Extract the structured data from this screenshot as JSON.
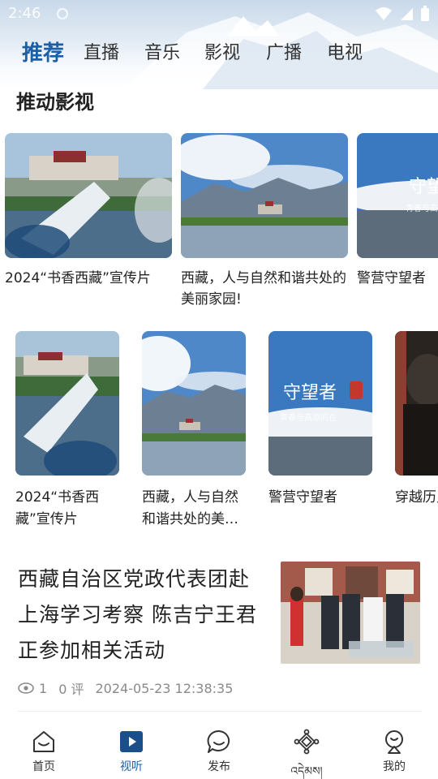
{
  "status_bar": {
    "time": "2:46"
  },
  "tabs": [
    {
      "label": "推荐",
      "active": true
    },
    {
      "label": "直播"
    },
    {
      "label": "音乐"
    },
    {
      "label": "影视"
    },
    {
      "label": "广播"
    },
    {
      "label": "电视"
    }
  ],
  "section": {
    "title": "推动影视"
  },
  "row1": [
    {
      "caption": "2024“书香西藏”宣传片",
      "image": "potala-reading"
    },
    {
      "caption": "西藏，人与自然和谐共处的美丽家园!",
      "image": "lake-mountains"
    },
    {
      "caption": "警营守望者",
      "image": "guardians-poster",
      "poster_text": "守望者",
      "poster_sub": "青春与高原同在"
    }
  ],
  "row2": [
    {
      "caption": "2024“书香西藏”宣传片",
      "image": "potala-reading"
    },
    {
      "caption": "西藏，人与自然和谐共处的美丽家园!",
      "image": "lake-mountains"
    },
    {
      "caption": "警营守望者",
      "image": "guardians-poster",
      "poster_text": "守望者",
      "poster_sub": "青春与高原同在"
    },
    {
      "caption": "穿越历史对话",
      "image": "dark-portrait"
    }
  ],
  "news": {
    "title": "西藏自治区党政代表团赴上海学习考察 陈吉宁王君正参加相关活动",
    "views": "1",
    "comments": "0 评",
    "date": "2024-05-23 12:38:35",
    "image": "delegation-visit"
  },
  "bottom_nav": [
    {
      "label": "首页",
      "icon": "home-icon"
    },
    {
      "label": "视听",
      "icon": "play-icon",
      "active": true
    },
    {
      "label": "发布",
      "icon": "chat-icon"
    },
    {
      "label": "འདེམས།",
      "icon": "endless-knot-icon"
    },
    {
      "label": "我的",
      "icon": "profile-icon"
    }
  ],
  "colors": {
    "accent": "#1b5fa6",
    "text": "#222222",
    "meta": "#8a8a8a"
  }
}
